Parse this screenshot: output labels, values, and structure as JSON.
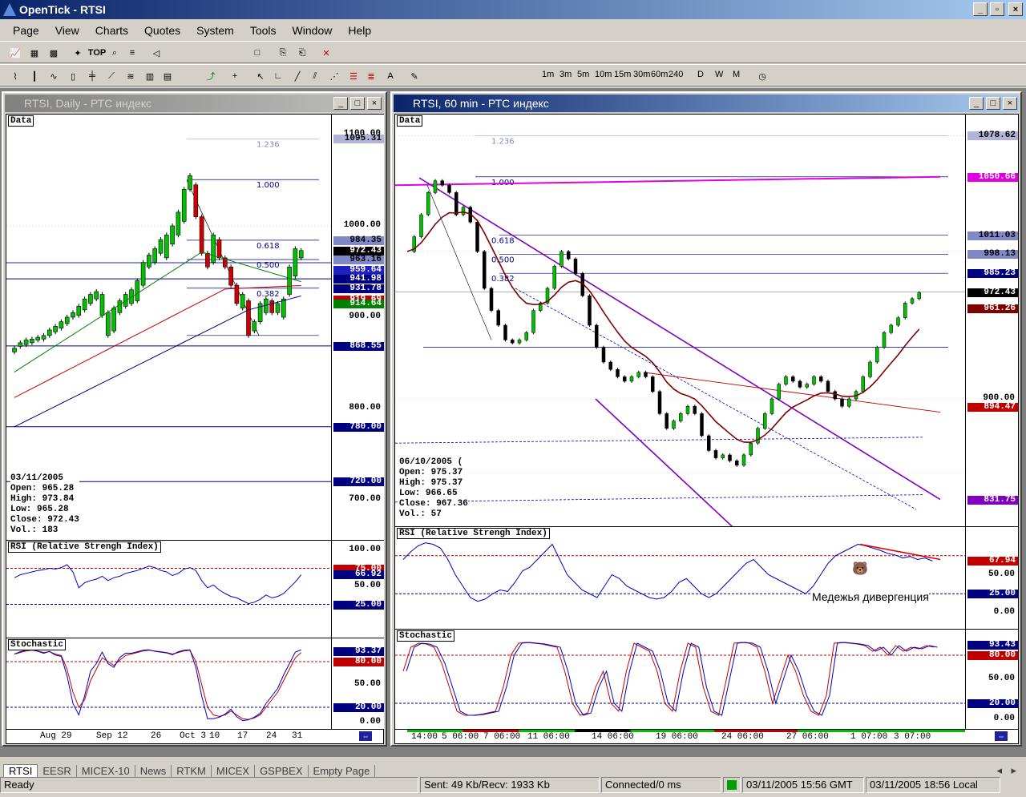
{
  "app": {
    "title": "OpenTick - RTSI"
  },
  "menu": [
    "Page",
    "View",
    "Charts",
    "Quotes",
    "System",
    "Tools",
    "Window",
    "Help"
  ],
  "toolbar1": {
    "top_label": "TOP"
  },
  "toolbar2": {
    "periods": [
      "1m",
      "3m",
      "5m",
      "10m",
      "15m",
      "30m",
      "60m",
      "240",
      "D",
      "W",
      "M"
    ]
  },
  "left_window": {
    "title": "RTSI, Daily - РТС индекс",
    "data_label": "Data",
    "price_ticks": [
      "1100.00",
      "1000.00",
      "900.00",
      "800.00",
      "700.00"
    ],
    "price_tags": [
      {
        "v": "1095.31",
        "bg": "#b0b4d8",
        "fg": "#000"
      },
      {
        "v": "984.35",
        "bg": "#8088c8",
        "fg": "#000"
      },
      {
        "v": "972.43",
        "bg": "#000000",
        "fg": "#fff"
      },
      {
        "v": "963.16",
        "bg": "#8088c8",
        "fg": "#000"
      },
      {
        "v": "959.64",
        "bg": "#2020c0",
        "fg": "#fff"
      },
      {
        "v": "941.98",
        "bg": "#000080",
        "fg": "#fff"
      },
      {
        "v": "931.78",
        "bg": "#000080",
        "fg": "#fff"
      },
      {
        "v": "919.69",
        "bg": "#c00000",
        "fg": "#fff"
      },
      {
        "v": "914.64",
        "bg": "#008000",
        "fg": "#fff"
      },
      {
        "v": "868.55",
        "bg": "#000080",
        "fg": "#fff"
      },
      {
        "v": "780.00",
        "bg": "#000080",
        "fg": "#fff"
      },
      {
        "v": "720.00",
        "bg": "#000080",
        "fg": "#fff"
      }
    ],
    "fib": [
      "1.236",
      "1.000",
      "0.618",
      "0.500",
      "0.382"
    ],
    "info": {
      "date": "03/11/2005",
      "open": "Open: 965.28",
      "high": "High: 973.84",
      "low": "Low: 965.28",
      "close": "Close: 972.43",
      "vol": "Vol.: 183"
    },
    "rsi_label": "RSI (Relative Strengh Index)",
    "rsi_ticks": [
      "100.00",
      "50.00"
    ],
    "rsi_tags": [
      {
        "v": "75.00",
        "bg": "#c00000",
        "fg": "#fff"
      },
      {
        "v": "66.92",
        "bg": "#000080",
        "fg": "#fff"
      },
      {
        "v": "25.00",
        "bg": "#000080",
        "fg": "#fff"
      }
    ],
    "stoch_label": "Stochastic",
    "stoch_ticks": [
      "50.00",
      "0.00"
    ],
    "stoch_tags": [
      {
        "v": "93.37",
        "bg": "#000080",
        "fg": "#fff"
      },
      {
        "v": "80.00",
        "bg": "#c00000",
        "fg": "#fff"
      },
      {
        "v": "20.00",
        "bg": "#000080",
        "fg": "#fff"
      }
    ],
    "x_labels": [
      "Aug 29",
      "Sep 12",
      "26",
      "Oct 3",
      "10",
      "17",
      "24",
      "31"
    ]
  },
  "right_window": {
    "title": "RTSI, 60 min - РТС индекс",
    "data_label": "Data",
    "price_ticks": [
      "900.00"
    ],
    "price_tags": [
      {
        "v": "1078.62",
        "bg": "#b0b4d8",
        "fg": "#000"
      },
      {
        "v": "1050.66",
        "bg": "#e000e0",
        "fg": "#fff"
      },
      {
        "v": "1011.03",
        "bg": "#8088c8",
        "fg": "#000"
      },
      {
        "v": "998.13",
        "bg": "#8088c8",
        "fg": "#000"
      },
      {
        "v": "985.23",
        "bg": "#000080",
        "fg": "#fff"
      },
      {
        "v": "972.43",
        "bg": "#000000",
        "fg": "#fff"
      },
      {
        "v": "961.26",
        "bg": "#800000",
        "fg": "#fff"
      },
      {
        "v": "894.47",
        "bg": "#c00000",
        "fg": "#fff"
      },
      {
        "v": "831.75",
        "bg": "#8000c0",
        "fg": "#fff"
      }
    ],
    "fib": [
      "1.236",
      "1.000",
      "0.618",
      "0.500",
      "0.382"
    ],
    "info": {
      "date": "06/10/2005 (",
      "open": "Open: 975.37",
      "high": "High: 975.37",
      "low": "Low: 966.65",
      "close": "Close: 967.36",
      "vol": "Vol.: 57"
    },
    "rsi_label": "RSI (Relative Strengh Index)",
    "rsi_ticks": [
      "50.00",
      "0.00"
    ],
    "rsi_tags": [
      {
        "v": "67.94",
        "bg": "#c00000",
        "fg": "#fff"
      },
      {
        "v": "25.00",
        "bg": "#000080",
        "fg": "#fff"
      }
    ],
    "annotation": "Медежья дивергенция",
    "stoch_label": "Stochastic",
    "stoch_ticks": [
      "50.00",
      "0.00"
    ],
    "stoch_tags": [
      {
        "v": "93.43",
        "bg": "#000080",
        "fg": "#fff"
      },
      {
        "v": "80.00",
        "bg": "#c00000",
        "fg": "#fff"
      },
      {
        "v": "20.00",
        "bg": "#000080",
        "fg": "#fff"
      }
    ],
    "x_labels": [
      "14:00",
      "5 06:00",
      "7 06:00",
      "11 06:00",
      "14 06:00",
      "19 06:00",
      "24 06:00",
      "27 06:00",
      "1 07:00",
      "3 07:00"
    ]
  },
  "tabs": [
    "RTSI",
    "EESR",
    "MICEX-10",
    "News",
    "RTKM",
    "MICEX",
    "GSPBEX",
    "Empty Page"
  ],
  "status": {
    "ready": "Ready",
    "sent": "Sent: 49 Kb/Recv: 1933 Kb",
    "connected": "Connected/0 ms",
    "gmt": "03/11/2005 15:56 GMT",
    "local": "03/11/2005 18:56 Local"
  }
}
